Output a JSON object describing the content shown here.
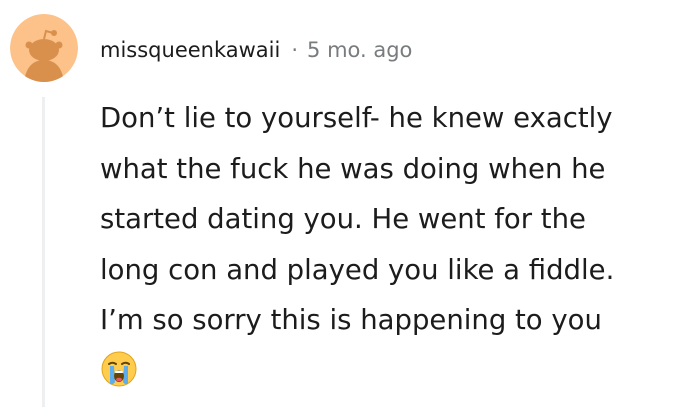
{
  "comment": {
    "username": "missqueenkawaii",
    "separator": "·",
    "timestamp": "5 mo. ago",
    "lines": [
      "Don’t lie to yourself- he knew exactly",
      "what the fuck he was doing when he",
      "started dating you. He went for the",
      "long con and played you like a fiddle.",
      "I’m so sorry this is happening to you"
    ],
    "emoji": "loudly-crying-face-icon"
  },
  "colors": {
    "avatar_bg": "#fcc28a",
    "avatar_figure": "#d9904d",
    "text": "#1c1c1c",
    "meta": "#787c7e",
    "thread_line": "#edeff1"
  }
}
